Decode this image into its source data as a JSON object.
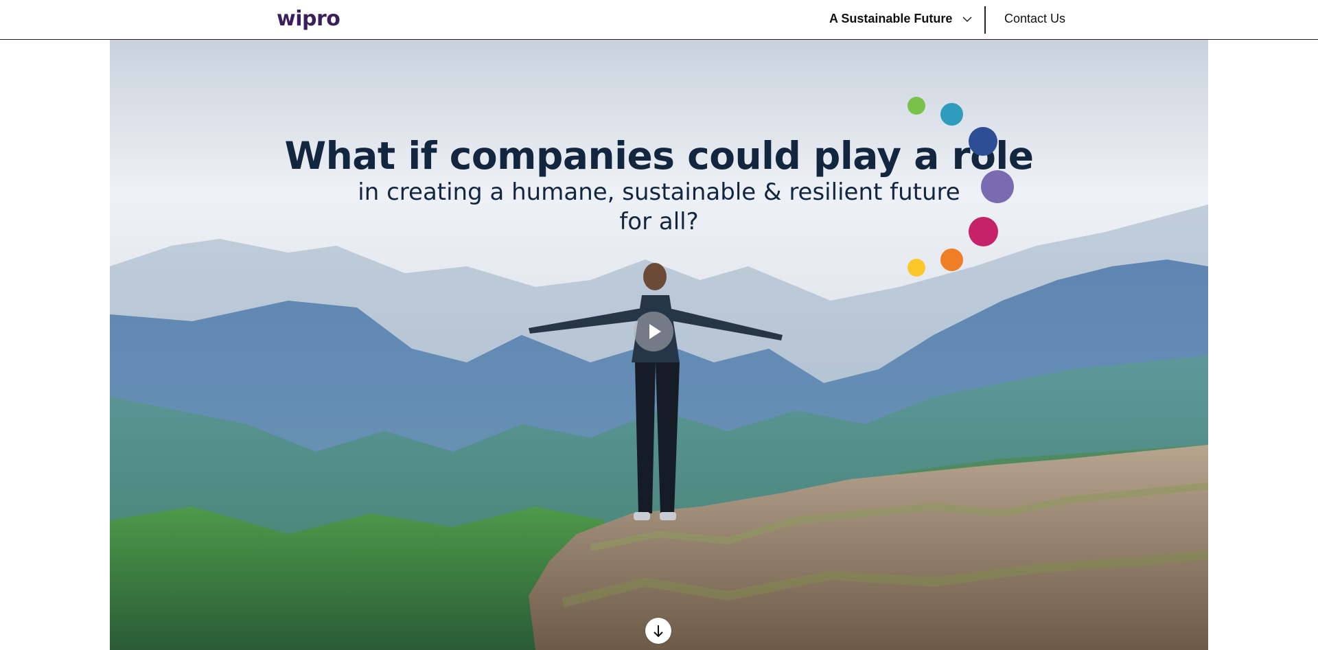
{
  "header": {
    "logo_text": "wipro",
    "nav_dropdown_label": "A Sustainable Future",
    "contact_label": "Contact Us"
  },
  "hero": {
    "headline": "What if companies could play a role",
    "subline_1": "in creating a humane, sustainable & resilient future",
    "subline_2": "for all?",
    "play_icon": "play-icon",
    "scroll_icon": "arrow-down-icon"
  },
  "colors": {
    "logo": "#3a1f5c",
    "headline": "#12263f",
    "dots": [
      "#7ac14a",
      "#2f9bbd",
      "#2d4e94",
      "#7a6bb0",
      "#c6226a",
      "#f07e26",
      "#fcc72a"
    ]
  }
}
